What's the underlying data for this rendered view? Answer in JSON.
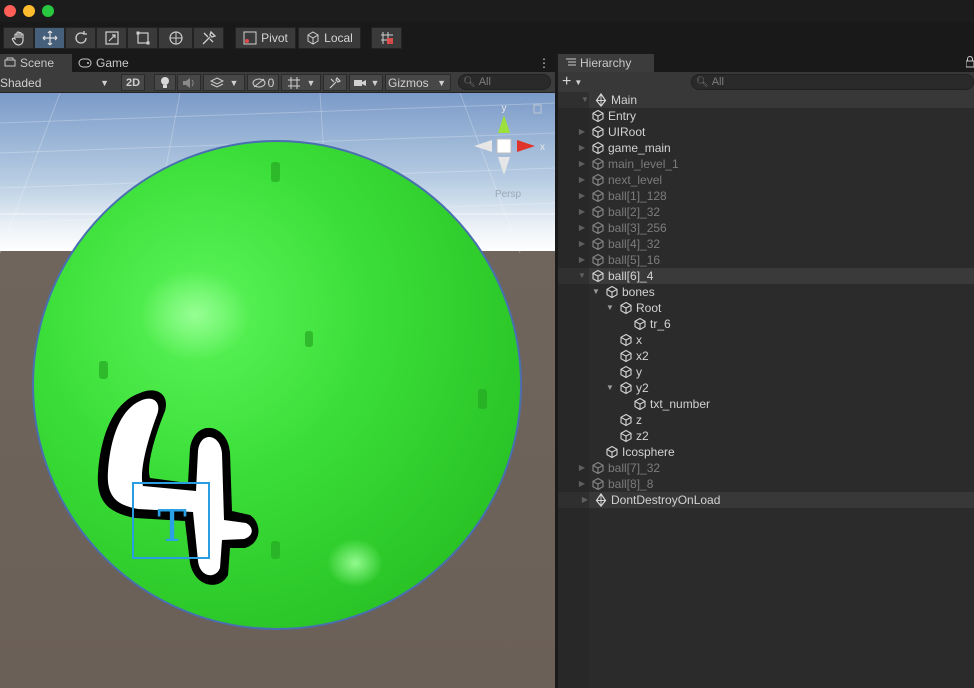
{
  "window": {
    "traffic_lights": [
      "#ff5f57",
      "#febc2e",
      "#28c840"
    ]
  },
  "toolbar": {
    "pivot_label": "Pivot",
    "local_label": "Local"
  },
  "scene_panel": {
    "tabs": [
      {
        "label": "Scene"
      },
      {
        "label": "Game"
      }
    ],
    "shading_mode": "Shaded",
    "mode_2d": "2D",
    "hidden_count": "0",
    "gizmos_label": "Gizmos",
    "search_placeholder": "All",
    "persp_label": "Persp",
    "axis_y": "y",
    "axis_x": "x",
    "ball_number": "4",
    "ball_color": "#2ee52b"
  },
  "hierarchy": {
    "tab_label": "Hierarchy",
    "add_label": "+",
    "search_placeholder": "All",
    "rows": [
      {
        "label": "Main",
        "depth": 0,
        "arrow": "open",
        "icon": "unity-scene-icon",
        "scene": true
      },
      {
        "label": "Entry",
        "depth": 1,
        "arrow": "none",
        "icon": "gameobject-cube-icon"
      },
      {
        "label": "UIRoot",
        "depth": 1,
        "arrow": "closed",
        "icon": "gameobject-cube-icon"
      },
      {
        "label": "game_main",
        "depth": 1,
        "arrow": "closed",
        "icon": "gameobject-cube-icon"
      },
      {
        "label": "main_level_1",
        "depth": 1,
        "arrow": "closed",
        "icon": "gameobject-cube-icon",
        "inactive": true
      },
      {
        "label": "next_level",
        "depth": 1,
        "arrow": "closed",
        "icon": "gameobject-cube-icon",
        "inactive": true
      },
      {
        "label": "ball[1]_128",
        "depth": 1,
        "arrow": "closed",
        "icon": "gameobject-cube-icon",
        "inactive": true
      },
      {
        "label": "ball[2]_32",
        "depth": 1,
        "arrow": "closed",
        "icon": "gameobject-cube-icon",
        "inactive": true
      },
      {
        "label": "ball[3]_256",
        "depth": 1,
        "arrow": "closed",
        "icon": "gameobject-cube-icon",
        "inactive": true
      },
      {
        "label": "ball[4]_32",
        "depth": 1,
        "arrow": "closed",
        "icon": "gameobject-cube-icon",
        "inactive": true
      },
      {
        "label": "ball[5]_16",
        "depth": 1,
        "arrow": "closed",
        "icon": "gameobject-cube-icon",
        "inactive": true
      },
      {
        "label": "ball[6]_4",
        "depth": 1,
        "arrow": "open",
        "icon": "gameobject-cube-icon",
        "selected": true
      },
      {
        "label": "bones",
        "depth": 2,
        "arrow": "open",
        "icon": "gameobject-cube-icon"
      },
      {
        "label": "Root",
        "depth": 3,
        "arrow": "open",
        "icon": "gameobject-cube-icon"
      },
      {
        "label": "tr_6",
        "depth": 4,
        "arrow": "none",
        "icon": "gameobject-cube-icon"
      },
      {
        "label": "x",
        "depth": 3,
        "arrow": "none",
        "icon": "gameobject-cube-icon"
      },
      {
        "label": "x2",
        "depth": 3,
        "arrow": "none",
        "icon": "gameobject-cube-icon"
      },
      {
        "label": "y",
        "depth": 3,
        "arrow": "none",
        "icon": "gameobject-cube-icon"
      },
      {
        "label": "y2",
        "depth": 3,
        "arrow": "open",
        "icon": "gameobject-cube-icon"
      },
      {
        "label": "txt_number",
        "depth": 4,
        "arrow": "none",
        "icon": "gameobject-cube-icon"
      },
      {
        "label": "z",
        "depth": 3,
        "arrow": "none",
        "icon": "gameobject-cube-icon"
      },
      {
        "label": "z2",
        "depth": 3,
        "arrow": "none",
        "icon": "gameobject-cube-icon"
      },
      {
        "label": "Icosphere",
        "depth": 2,
        "arrow": "none",
        "icon": "gameobject-cube-icon"
      },
      {
        "label": "ball[7]_32",
        "depth": 1,
        "arrow": "closed",
        "icon": "gameobject-cube-icon",
        "inactive": true
      },
      {
        "label": "ball[8]_8",
        "depth": 1,
        "arrow": "closed",
        "icon": "gameobject-cube-icon",
        "inactive": true
      },
      {
        "label": "DontDestroyOnLoad",
        "depth": 0,
        "arrow": "closed",
        "icon": "unity-scene-icon",
        "scene": true
      }
    ]
  }
}
